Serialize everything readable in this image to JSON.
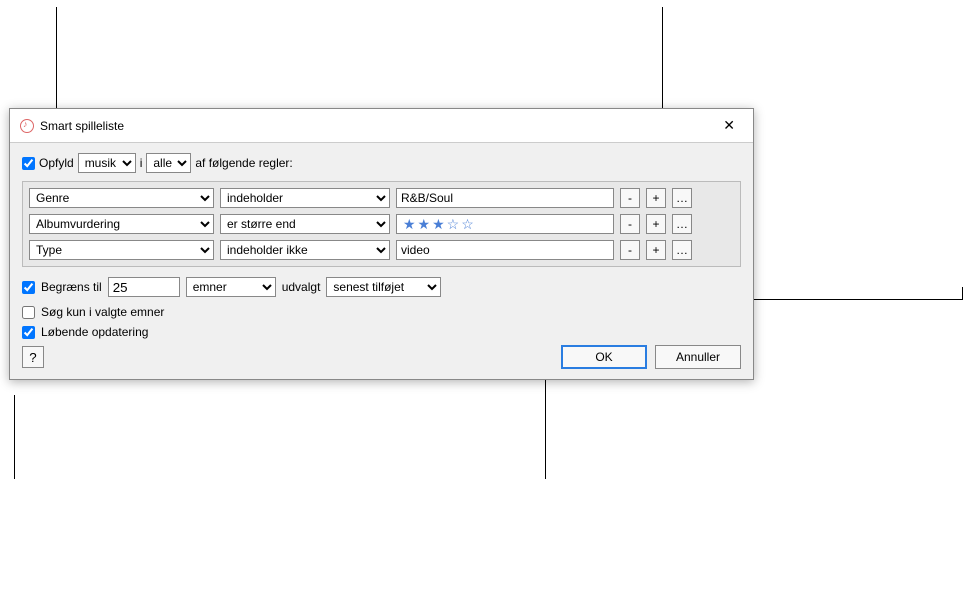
{
  "dialog": {
    "title": "Smart spilleliste",
    "match": {
      "checkbox_checked": true,
      "label_prefix": "Opfyld",
      "media_select": "musik",
      "connector": "i",
      "scope_select": "alle",
      "label_suffix": "af følgende regler:"
    },
    "rules": [
      {
        "field": "Genre",
        "operator": "indeholder",
        "value": "R&B/Soul",
        "value_type": "text"
      },
      {
        "field": "Albumvurdering",
        "operator": "er større end",
        "value": "★★★☆☆",
        "value_type": "stars"
      },
      {
        "field": "Type",
        "operator": "indeholder ikke",
        "value": "video",
        "value_type": "text"
      }
    ],
    "rule_buttons": {
      "remove": "-",
      "add": "+",
      "more": "…"
    },
    "limit": {
      "checked": true,
      "label": "Begræns til",
      "value": "25",
      "unit": "emner",
      "selected_label": "udvalgt",
      "sort": "senest tilføjet"
    },
    "only_checked": {
      "checked": false,
      "label": "Søg kun i valgte emner"
    },
    "live_update": {
      "checked": true,
      "label": "Løbende opdatering"
    },
    "buttons": {
      "help": "?",
      "ok": "OK",
      "cancel": "Annuller"
    }
  }
}
